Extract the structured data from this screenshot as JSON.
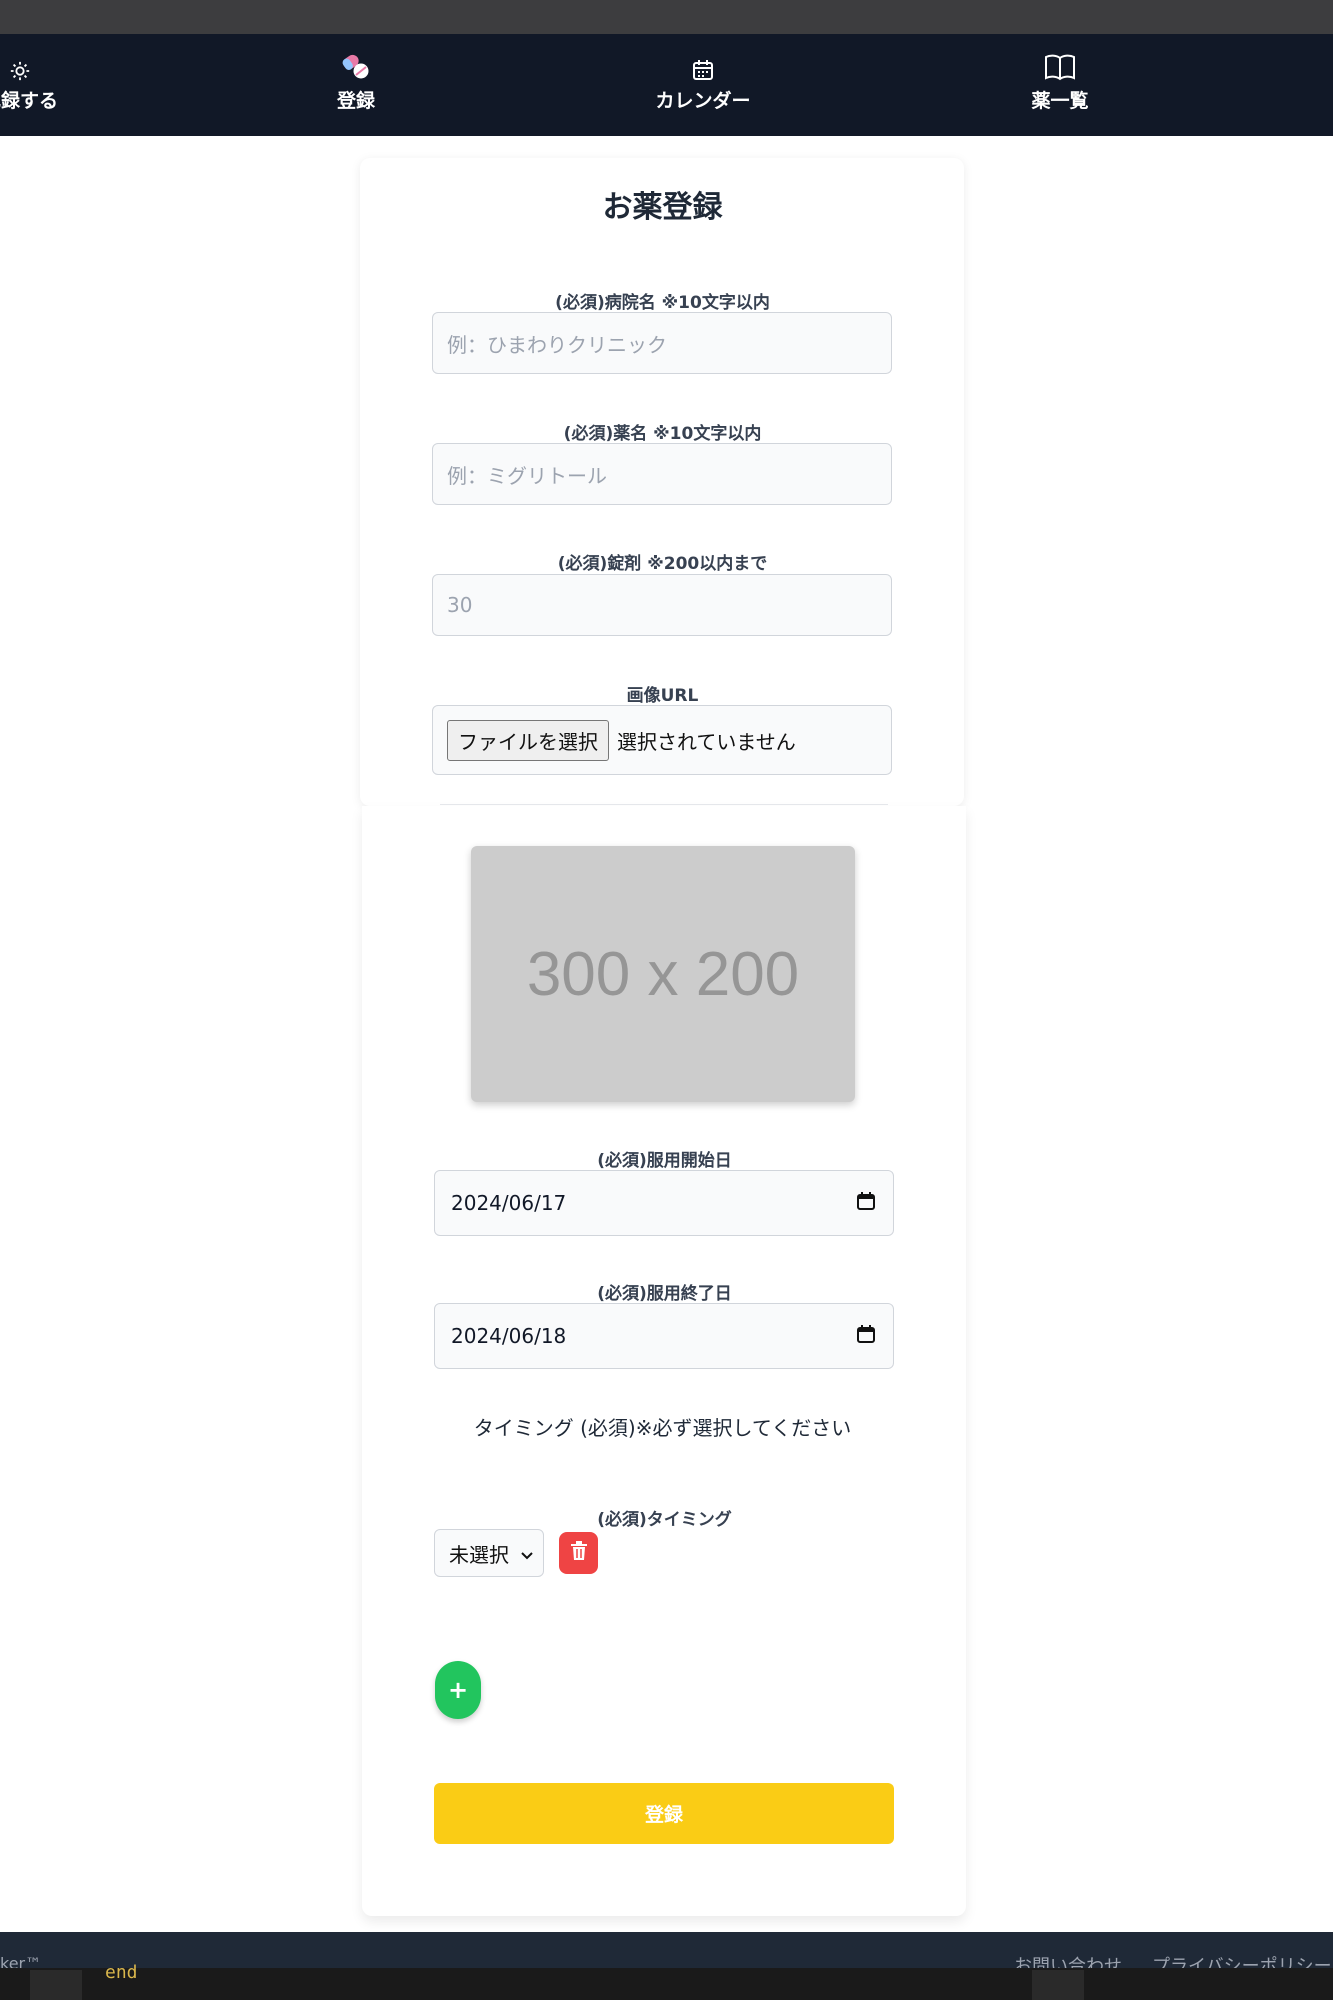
{
  "nav": {
    "items": [
      {
        "label": "記録する",
        "icon": "gear-icon"
      },
      {
        "label": "登録",
        "icon": "pills-icon"
      },
      {
        "label": "カレンダー",
        "icon": "calendar-icon"
      },
      {
        "label": "薬一覧",
        "icon": "book-icon"
      }
    ]
  },
  "form": {
    "title": "お薬登録",
    "hospital": {
      "label": "(必須)病院名 ※10文字以内",
      "placeholder": "例：ひまわりクリニック"
    },
    "medicine": {
      "label": "(必須)薬名 ※10文字以内",
      "placeholder": "例：ミグリトール"
    },
    "tablets": {
      "label": "(必須)錠剤 ※200以内まで",
      "placeholder": "30"
    },
    "image": {
      "label": "画像URL",
      "button": "ファイルを選択",
      "status": "選択されていません"
    },
    "preview_text": "300 x 200",
    "start_date": {
      "label": "(必須)服用開始日",
      "value": "2024/06/17"
    },
    "end_date": {
      "label": "(必須)服用終了日",
      "value": "2024/06/18"
    },
    "timing_note": "タイミング (必須)※必ず選択してください",
    "timing": {
      "label": "(必須)タイミング",
      "selected": "未選択"
    },
    "add_label": "+",
    "submit_label": "登録"
  },
  "footer": {
    "brand": "ker™",
    "contact": "お問い合わせ",
    "privacy": "プライバシーポリシー"
  },
  "editor": {
    "code": "end"
  }
}
